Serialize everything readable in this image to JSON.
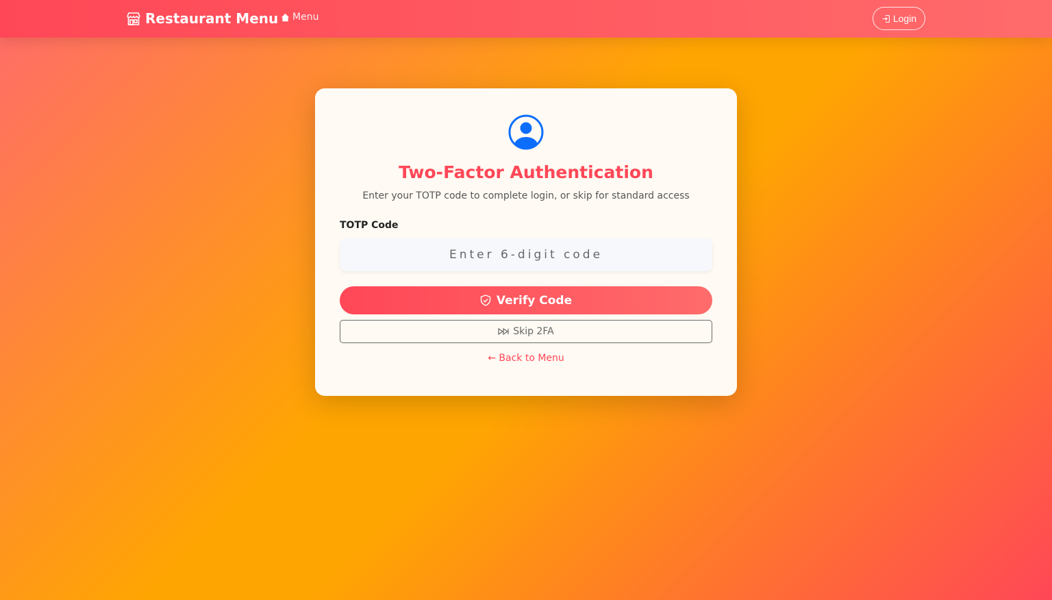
{
  "navbar": {
    "brand": "Restaurant Menu",
    "brand_icon": "shop-icon",
    "menu_link": "Menu",
    "menu_icon": "house-icon",
    "login_label": "Login",
    "login_icon": "login-icon"
  },
  "auth": {
    "icon": "person-circle-icon",
    "title": "Two-Factor Authentication",
    "subtitle": "Enter your TOTP code to complete login, or skip for standard access",
    "field_label": "TOTP Code",
    "code_value": "",
    "code_placeholder": "Enter 6-digit code",
    "verify_label": "Verify Code",
    "verify_icon": "shield-check-icon",
    "skip_label": "Skip 2FA",
    "skip_icon": "fast-forward-icon",
    "back_label": "← Back to Menu"
  },
  "colors": {
    "accent": "#ff4757",
    "accent_light": "#ff6b6b",
    "background_mid": "#ffa502",
    "icon_blue": "#0d6efd",
    "card": "#fffaf3"
  }
}
